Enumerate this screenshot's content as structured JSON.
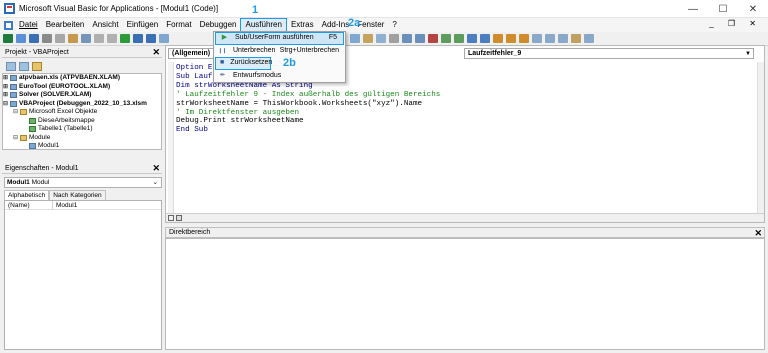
{
  "window": {
    "title": "Microsoft Visual Basic for Applications - [Modul1 (Code)]",
    "controls": [
      "—",
      "☐",
      "✕"
    ]
  },
  "menubar": {
    "items": [
      "Datei",
      "Bearbeiten",
      "Ansicht",
      "Einfügen",
      "Format",
      "Debuggen",
      "Ausführen",
      "Extras",
      "Add-Ins",
      "Fenster",
      "?"
    ],
    "mdi_controls": "_ ❐ ✕"
  },
  "annotations": {
    "marker_1": "1",
    "marker_2a": "2a",
    "marker_2b": "2b",
    "color": "#1e9be6"
  },
  "run_menu": {
    "items": [
      {
        "label": "Sub/UserForm ausführen",
        "shortcut": "F5",
        "icon": "play-icon",
        "glyph": "▶"
      },
      {
        "label": "Unterbrechen",
        "shortcut": "Strg+Unterbrechen",
        "icon": "pause-icon",
        "glyph": "❙❙"
      },
      {
        "label": "Zurücksetzen",
        "shortcut": "",
        "icon": "stop-icon",
        "glyph": "■"
      },
      {
        "label": "Entwurfsmodus",
        "shortcut": "",
        "icon": "design-mode-icon",
        "glyph": "✒"
      }
    ]
  },
  "project_pane": {
    "title": "Projekt - VBAProject",
    "tree": [
      {
        "label": "atpvbaen.xls (ATPVBAEN.XLAM)",
        "bold": true,
        "level": 0
      },
      {
        "label": "EuroTool (EUROTOOL.XLAM)",
        "bold": true,
        "level": 0
      },
      {
        "label": "Solver (SOLVER.XLAM)",
        "bold": true,
        "level": 0
      },
      {
        "label": "VBAProject (Debuggen_2022_10_13.xlsm",
        "bold": true,
        "level": 0
      },
      {
        "label": "Microsoft Excel Objekte",
        "bold": false,
        "level": 1
      },
      {
        "label": "DieseArbeitsmappe",
        "bold": false,
        "level": 2
      },
      {
        "label": "Tabelle1 (Tabelle1)",
        "bold": false,
        "level": 2
      },
      {
        "label": "Module",
        "bold": false,
        "level": 1
      },
      {
        "label": "Modul1",
        "bold": false,
        "level": 2
      }
    ]
  },
  "properties_pane": {
    "title": "Eigenschaften - Modul1",
    "object_name": "Modul1",
    "object_type": "Modul",
    "tabs": [
      "Alphabetisch",
      "Nach Kategorien"
    ],
    "rows": [
      {
        "key": "(Name)",
        "value": "Modul1"
      }
    ]
  },
  "code_window": {
    "object_combo": "(Allgemein)",
    "proc_combo": "Laufzeitfehler_9",
    "lines": [
      {
        "text": "Option Explicit",
        "cls": "kw"
      },
      {
        "text": "Sub Laufzeitfehler_9()",
        "cls": "kw"
      },
      {
        "text": "Dim strWorksheetName As String",
        "cls": "kw"
      },
      {
        "text": "' Laufzeitfehler 9 - Index außerhalb des gültigen Bereichs",
        "cls": "cm"
      },
      {
        "text": "strWorksheetName = ThisWorkbook.Worksheets(\"xyz\").Name",
        "cls": ""
      },
      {
        "text": "' Im Direktfenster ausgeben",
        "cls": "cm"
      },
      {
        "text": "Debug.Print strWorksheetName",
        "cls": ""
      },
      {
        "text": "End Sub",
        "cls": "kw"
      }
    ]
  },
  "immediate_pane": {
    "title": "Direktbereich"
  }
}
